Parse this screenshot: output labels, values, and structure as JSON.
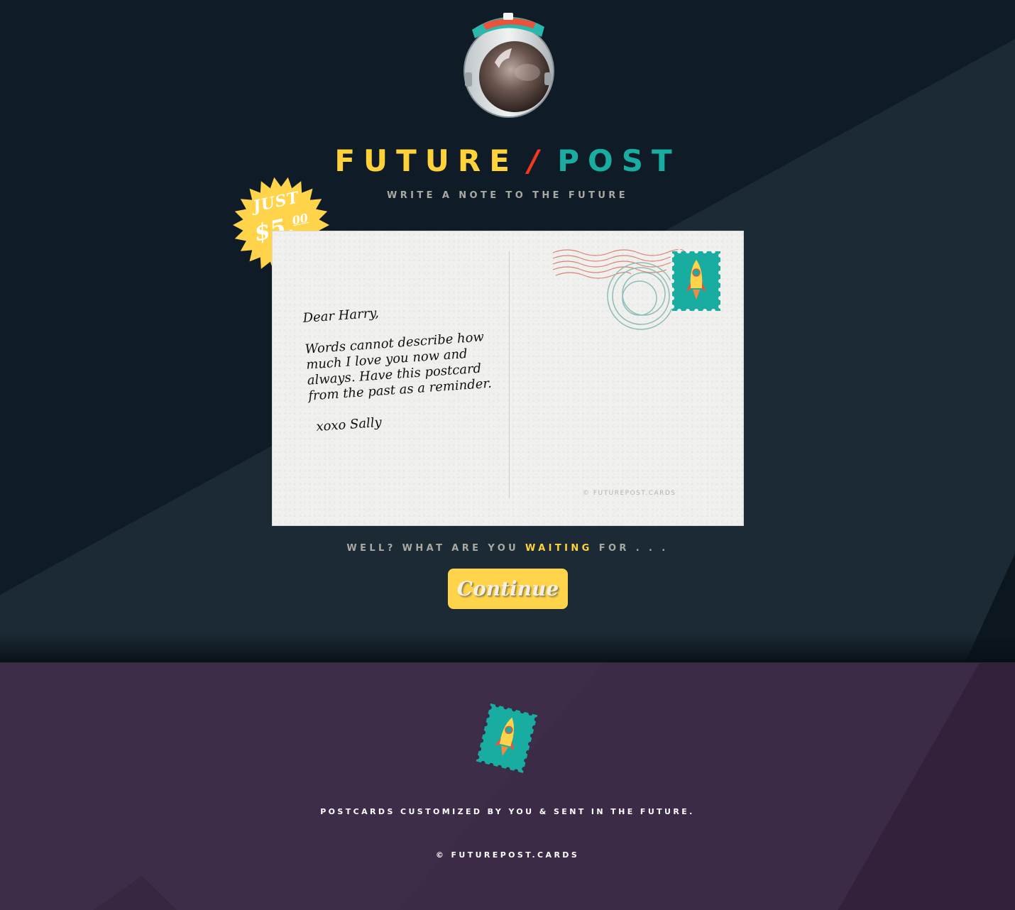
{
  "brand": {
    "word1": "FUTURE",
    "slash": "/",
    "word2": "POST"
  },
  "tagline": "WRITE A NOTE TO THE FUTURE",
  "badge": {
    "line1": "JUST",
    "price_main": "$5.",
    "price_cents": "00"
  },
  "postcard": {
    "greeting": "Dear Harry,",
    "body": "Words cannot describe how much I love you now and always. Have this postcard from the past as a reminder.",
    "signoff": "xoxo Sally",
    "watermark": "© FUTUREPOST.CARDS"
  },
  "cta": {
    "prefix": "WELL? WHAT ARE YOU",
    "highlight": "WAITING",
    "suffix": "FOR . . ."
  },
  "continue_label": "Continue",
  "footer": {
    "tagline": "POSTCARDS CUSTOMIZED BY YOU & SENT IN THE FUTURE.",
    "copyright": "© FUTUREPOST.CARDS"
  },
  "colors": {
    "yellow": "#ffd23a",
    "red": "#f2391f",
    "teal": "#19ada2",
    "hero_bg": "#0f1c27",
    "footer_bg": "#3b2b46"
  },
  "icons": [
    "astronaut-helmet-icon",
    "price-burst-badge",
    "rocket-stamp-icon",
    "postmark-icon"
  ]
}
